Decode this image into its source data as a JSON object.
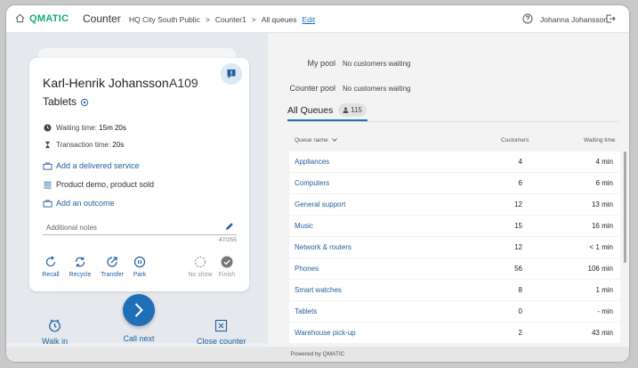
{
  "header": {
    "brand": "QMATIC",
    "app_title": "Counter",
    "breadcrumbs": [
      "HQ City South Public",
      ">",
      "Counter1",
      ">",
      "All queues"
    ],
    "edit_label": "Edit",
    "user_name": "Johanna Johansson"
  },
  "customer": {
    "name": "Karl-Henrik Johansson",
    "ticket": "A109",
    "service": "Tablets",
    "waiting_label": "Waiting time:",
    "waiting_value": "15m 20s",
    "transaction_label": "Transaction time:",
    "transaction_value": "20s",
    "add_service_label": "Add a delivered service",
    "delivered_item": "Product demo, product sold",
    "add_outcome_label": "Add an outcome",
    "notes_placeholder": "Additional notes",
    "notes_count": "47/255"
  },
  "actions": [
    {
      "label": "Recall",
      "icon": "recall-icon",
      "enabled": true
    },
    {
      "label": "Recycle",
      "icon": "recycle-icon",
      "enabled": true
    },
    {
      "label": "Transfer",
      "icon": "transfer-icon",
      "enabled": true
    },
    {
      "label": "Park",
      "icon": "park-icon",
      "enabled": true
    },
    {
      "label": "No show",
      "icon": "no-show-icon",
      "enabled": false
    },
    {
      "label": "Finish",
      "icon": "finish-icon",
      "enabled": false
    }
  ],
  "bottom": {
    "walk_in": "Walk in",
    "call_next": "Call next",
    "close_counter": "Close counter"
  },
  "pools": {
    "my_pool_label": "My pool",
    "my_pool_value": "No customers waiting",
    "counter_pool_label": "Counter pool",
    "counter_pool_value": "No customers waiting"
  },
  "queues": {
    "title": "All Queues",
    "total": "115",
    "col_name": "Queue name",
    "col_customers": "Customers",
    "col_wait": "Waiting time",
    "rows": [
      {
        "name": "Appliances",
        "customers": "4",
        "wait": "4 min"
      },
      {
        "name": "Computers",
        "customers": "6",
        "wait": "6 min"
      },
      {
        "name": "General support",
        "customers": "12",
        "wait": "13 min"
      },
      {
        "name": "Music",
        "customers": "15",
        "wait": "16 min"
      },
      {
        "name": "Network & routers",
        "customers": "12",
        "wait": "< 1 min"
      },
      {
        "name": "Phones",
        "customers": "56",
        "wait": "106 min"
      },
      {
        "name": "Smart watches",
        "customers": "8",
        "wait": "1 min"
      },
      {
        "name": "Tablets",
        "customers": "0",
        "wait": "- min"
      },
      {
        "name": "Warehouse pick-up",
        "customers": "2",
        "wait": "43 min"
      }
    ]
  },
  "footer": "Powered by QMATIC",
  "colors": {
    "brand_green": "#19a974",
    "accent_blue": "#1f6fb6",
    "link_blue": "#1f5f9e"
  }
}
